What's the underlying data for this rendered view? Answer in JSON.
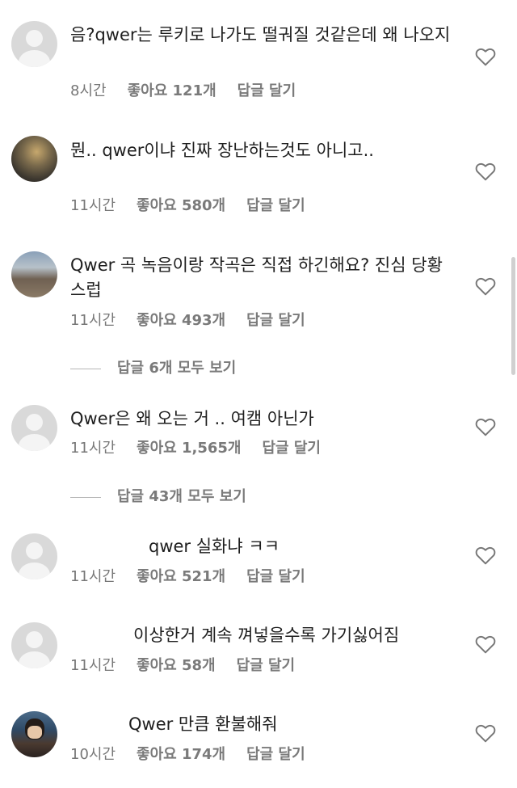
{
  "comments": [
    {
      "text": "음?qwer는 루키로 나가도 떨궈질 것같은데 왜 나오지",
      "time": "8시간",
      "likes": "좋아요 121개",
      "reply": "답글 달기"
    },
    {
      "text": "뭔.. qwer이냐 진짜 장난하는것도 아니고..",
      "time": "11시간",
      "likes": "좋아요 580개",
      "reply": "답글 달기"
    },
    {
      "text": "Qwer 곡 녹음이랑 작곡은 직접 하긴해요? 진심 당황스럽",
      "time": "11시간",
      "likes": "좋아요 493개",
      "reply": "답글 달기",
      "view_replies": "답글 6개 모두 보기"
    },
    {
      "text": "Qwer은 왜 오는 거 .. 여캠 아닌가",
      "time": "11시간",
      "likes": "좋아요 1,565개",
      "reply": "답글 달기",
      "view_replies": "답글 43개 모두 보기"
    },
    {
      "text": "qwer 실화냐 ㅋㅋ",
      "time": "11시간",
      "likes": "좋아요 521개",
      "reply": "답글 달기"
    },
    {
      "text": "이상한거 계속 껴넣을수록 가기싫어짐",
      "time": "11시간",
      "likes": "좋아요 58개",
      "reply": "답글 달기"
    },
    {
      "text": "Qwer 만큼 환불해줘",
      "time": "10시간",
      "likes": "좋아요 174개",
      "reply": "답글 달기"
    }
  ],
  "icons": {
    "like": "heart-outline-icon",
    "avatar_default": "default-avatar-icon"
  },
  "colors": {
    "text": "#1e1e1e",
    "meta": "#777777",
    "background": "#ffffff"
  }
}
